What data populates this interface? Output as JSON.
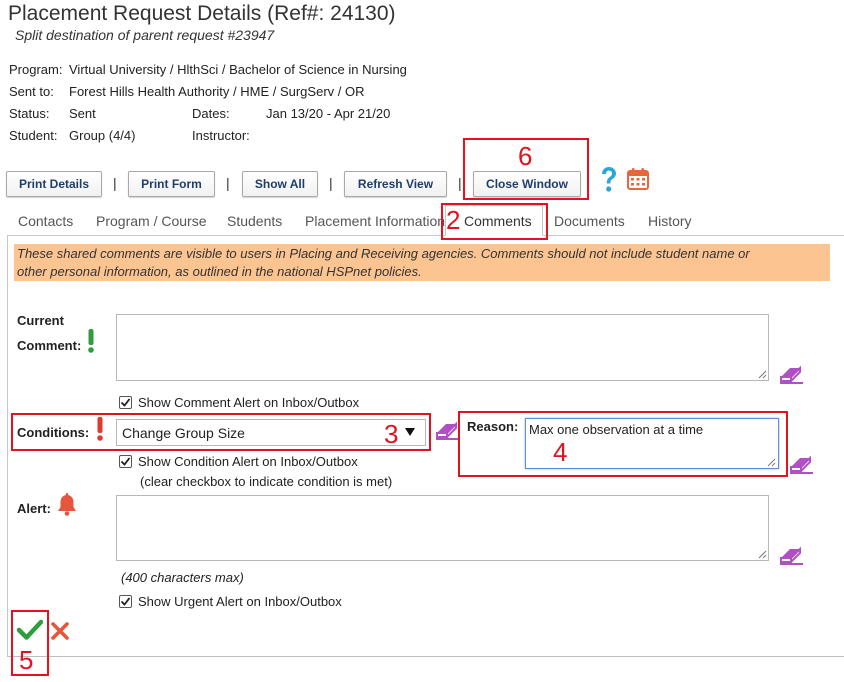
{
  "header": {
    "title": "Placement Request Details (Ref#: 24130)",
    "subtitle": "Split destination of parent request #23947"
  },
  "info": {
    "program_label": "Program:",
    "program_value": "Virtual University / HlthSci / Bachelor of Science in Nursing",
    "sent_to_label": "Sent to:",
    "sent_to_value": "Forest Hills Health Authority / HME / SurgServ / OR",
    "status_label": "Status:",
    "status_value": "Sent",
    "dates_label": "Dates:",
    "dates_value": "Jan 13/20 - Apr 21/20",
    "student_label": "Student:",
    "student_value": "Group (4/4)",
    "instructor_label": "Instructor:",
    "instructor_value": ""
  },
  "toolbar": {
    "print_details": "Print Details",
    "print_form": "Print Form",
    "show_all": "Show All",
    "refresh_view": "Refresh View",
    "close_window": "Close Window",
    "separator": "|"
  },
  "tabs": [
    {
      "label": "Contacts"
    },
    {
      "label": "Program / Course"
    },
    {
      "label": "Students"
    },
    {
      "label": "Placement Information"
    },
    {
      "label": "Comments",
      "active": true
    },
    {
      "label": "Documents"
    },
    {
      "label": "History"
    }
  ],
  "notice": {
    "line1": "These shared comments are visible to users in Placing and Receiving agencies. Comments should not include student name or",
    "line2": "other personal information, as outlined in the national HSPnet policies."
  },
  "form": {
    "current_comment_label_1": "Current",
    "current_comment_label_2": "Comment:",
    "current_comment_value": "",
    "show_comment_alert_label": "Show Comment Alert on Inbox/Outbox",
    "show_comment_alert_checked": true,
    "conditions_label": "Conditions:",
    "conditions_selected": "Change Group Size",
    "reason_label": "Reason:",
    "reason_value": "Max one observation at a time",
    "show_condition_alert_label": "Show Condition Alert on Inbox/Outbox",
    "show_condition_alert_checked": true,
    "condition_hint": "(clear checkbox to indicate condition is met)",
    "alert_label": "Alert:",
    "alert_value": "",
    "alert_max_hint": "(400 characters max)",
    "show_urgent_alert_label": "Show Urgent Alert on Inbox/Outbox",
    "show_urgent_alert_checked": true
  },
  "annotations": {
    "n2": "2",
    "n3": "3",
    "n4": "4",
    "n5": "5",
    "n6": "6"
  },
  "colors": {
    "notice_bg": "#fcc491",
    "annotation_red": "#e0131f",
    "required_green": "#2e9e3c",
    "required_red": "#e03a2e",
    "help_blue": "#2aa7d9",
    "calendar_orange": "#e8663a",
    "eraser_purple": "#b14fc5",
    "save_green": "#2e9e3c",
    "cancel_red": "#e8553d"
  },
  "icons": {
    "help": "help-icon",
    "calendar": "calendar-icon",
    "required": "exclamation-icon",
    "alert": "bell-icon",
    "eraser": "eraser-icon",
    "save": "checkmark-icon",
    "cancel": "close-icon"
  }
}
